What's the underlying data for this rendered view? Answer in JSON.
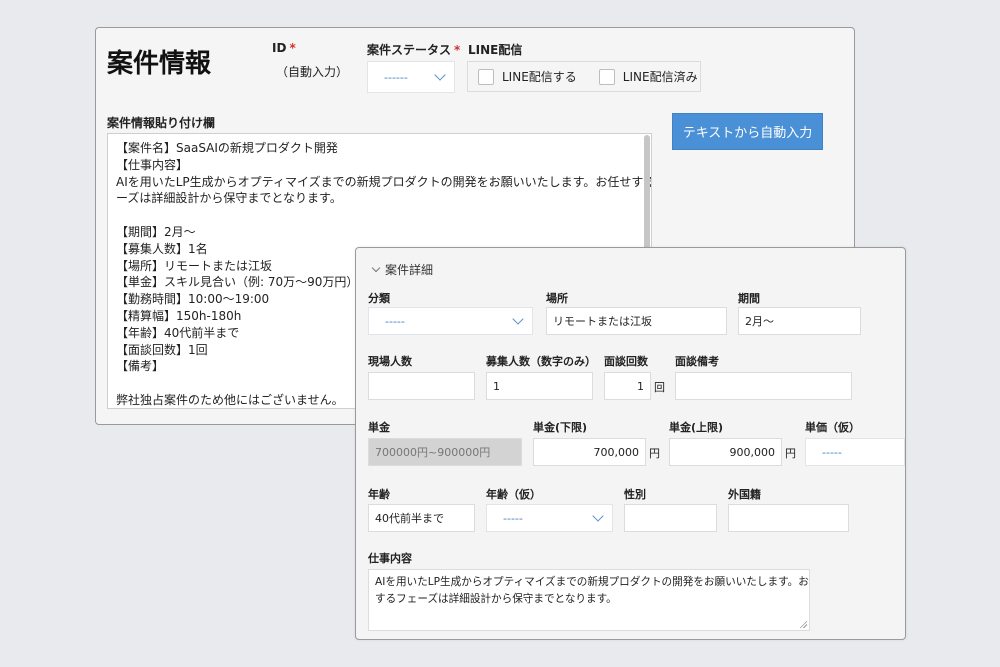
{
  "main": {
    "title": "案件情報",
    "id_label": "ID",
    "required_mark": "*",
    "id_value": "（自動入力）",
    "status_label": "案件ステータス",
    "status_value": "------",
    "line_label": "LINE配信",
    "line_send_label": "LINE配信する",
    "line_sent_label": "LINE配信済み",
    "paste_label": "案件情報貼り付け欄",
    "auto_fill_button": "テキストから自動入力",
    "paste_lines": [
      "【案件名】SaaSAIの新規プロダクト開発",
      "【仕事内容】",
      "AIを用いたLP生成からオプティマイズまでの新規プロダクトの開発をお願いいたします。お任せするフェ",
      "ーズは詳細設計から保守までとなります。",
      "",
      "【期間】2月～",
      "【募集人数】1名",
      "【場所】リモートまたは江坂",
      "【単金】スキル見合い（例: 70万～90万円）",
      "【勤務時間】10:00～19:00",
      "【精算幅】150h-180h",
      "【年齢】40代前半まで",
      "【面談回数】1回",
      "【備考】",
      "",
      "弊社独占案件のため他にはございません。"
    ]
  },
  "detail": {
    "section_title": "案件詳細",
    "category_label": "分類",
    "category_value": "-----",
    "location_label": "場所",
    "location_value": "リモートまたは江坂",
    "period_label": "期間",
    "period_value": "2月～",
    "onsite_count_label": "現場人数",
    "onsite_count_value": "",
    "recruit_count_label": "募集人数（数字のみ）",
    "recruit_count_value": "1",
    "interview_count_label": "面談回数",
    "interview_count_value": "1",
    "interview_unit": "回",
    "interview_note_label": "面談備考",
    "interview_note_value": "",
    "price_label": "単金",
    "price_value": "700000円~900000円",
    "price_min_label": "単金(下限)",
    "price_min_value": "700,000",
    "price_max_label": "単金(上限)",
    "price_max_value": "900,000",
    "yen_unit": "円",
    "price_tentative_label": "単価（仮）",
    "price_tentative_value": "-----",
    "age_label": "年齢",
    "age_value": "40代前半まで",
    "age_tentative_label": "年齢（仮）",
    "age_tentative_value": "-----",
    "gender_label": "性別",
    "gender_value": "",
    "foreign_label": "外国籍",
    "foreign_value": "",
    "job_label": "仕事内容",
    "job_lines": [
      "AIを用いたLP生成からオプティマイズまでの新規プロダクトの開発をお願いいたします。お任せ",
      "するフェーズは詳細設計から保守までとなります。"
    ]
  }
}
